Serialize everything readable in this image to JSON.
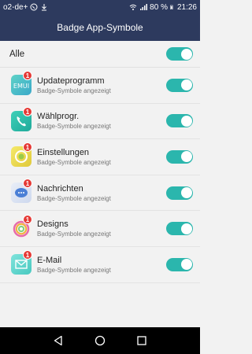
{
  "status_bar": {
    "carrier": "o2-de+",
    "battery": "80 %",
    "time": "21:26"
  },
  "header": {
    "title": "Badge App-Symbole"
  },
  "all_row": {
    "label": "Alle",
    "enabled": true
  },
  "apps": [
    {
      "name": "Updateprogramm",
      "subtitle": "Badge-Symbole angezeigt",
      "badge": "1",
      "enabled": true,
      "icon": "update-app-icon"
    },
    {
      "name": "Wählprogr.",
      "subtitle": "Badge-Symbole angezeigt",
      "badge": "1",
      "enabled": true,
      "icon": "phone-icon"
    },
    {
      "name": "Einstellungen",
      "subtitle": "Badge-Symbole angezeigt",
      "badge": "1",
      "enabled": true,
      "icon": "settings-icon"
    },
    {
      "name": "Nachrichten",
      "subtitle": "Badge-Symbole angezeigt",
      "badge": "1",
      "enabled": true,
      "icon": "messages-icon"
    },
    {
      "name": "Designs",
      "subtitle": "Badge-Symbole angezeigt",
      "badge": "1",
      "enabled": true,
      "icon": "themes-icon"
    },
    {
      "name": "E-Mail",
      "subtitle": "Badge-Symbole angezeigt",
      "badge": "1",
      "enabled": true,
      "icon": "email-icon"
    }
  ],
  "colors": {
    "header_bg": "#2d3a5e",
    "toggle_on": "#2bb6ad",
    "badge": "#e53935"
  }
}
